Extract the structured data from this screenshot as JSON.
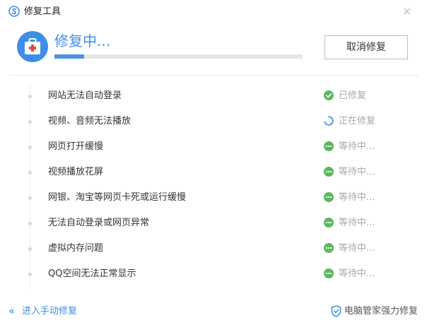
{
  "window": {
    "title": "修复工具",
    "close_glyph": "×",
    "logo_icon": "app-logo-icon"
  },
  "header": {
    "status_text": "修复中...",
    "progress_fraction": 0.12,
    "cancel_label": "取消修复",
    "badge_icon": "first-aid-kit-icon",
    "accent_color": "#3d8ee6"
  },
  "tasks": [
    {
      "label": "网站无法自动登录",
      "status": "done",
      "status_label": "已修复"
    },
    {
      "label": "视频、音频无法播放",
      "status": "running",
      "status_label": "正在修复"
    },
    {
      "label": "网页打开缓慢",
      "status": "waiting",
      "status_label": "等待中..."
    },
    {
      "label": "视频播放花屏",
      "status": "waiting",
      "status_label": "等待中..."
    },
    {
      "label": "网银、淘宝等网页卡死或运行缓慢",
      "status": "waiting",
      "status_label": "等待中..."
    },
    {
      "label": "无法自动登录或网页异常",
      "status": "waiting",
      "status_label": "等待中..."
    },
    {
      "label": "虚拟内存问题",
      "status": "waiting",
      "status_label": "等待中..."
    },
    {
      "label": "QQ空间无法正常显示",
      "status": "waiting",
      "status_label": "等待中..."
    }
  ],
  "status_colors": {
    "done": "#5cb85c",
    "waiting": "#5cb85c",
    "running": "#4a94e3"
  },
  "footer": {
    "manual_chevron": "«",
    "manual_label": "进入手动修复",
    "brand_label": "电脑管家强力修复",
    "brand_icon": "shield-icon"
  }
}
